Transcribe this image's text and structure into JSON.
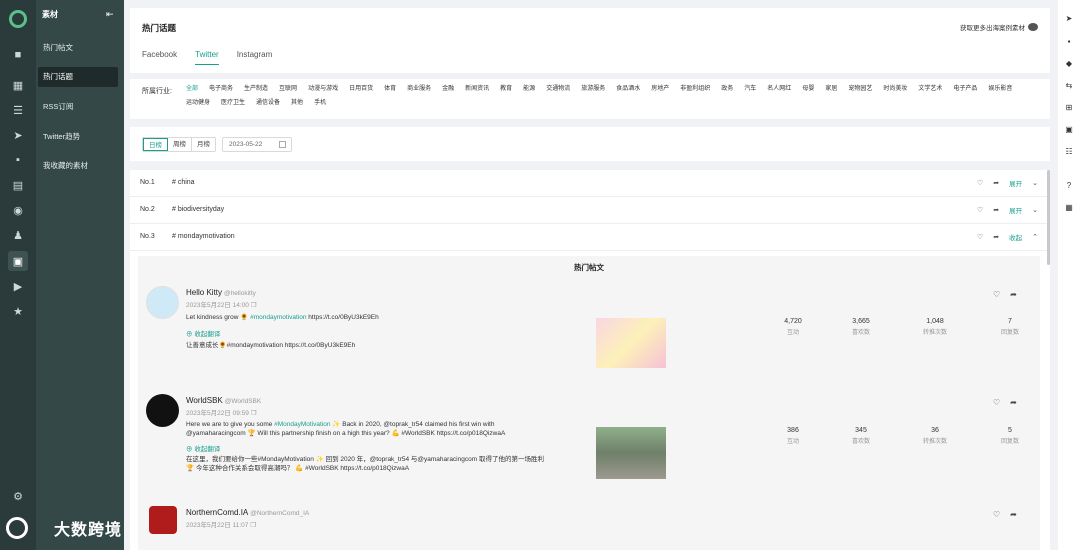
{
  "sidebar": {
    "title": "素材",
    "items": [
      {
        "label": "热门帖文",
        "active": false
      },
      {
        "label": "热门话题",
        "active": true
      },
      {
        "label": "RSS订阅",
        "active": false
      },
      {
        "label": "Twitter趋势",
        "active": false
      },
      {
        "label": "我收藏的素材",
        "active": false
      }
    ],
    "brand": "大数跨境"
  },
  "header": {
    "title": "热门话题",
    "more_link": "获取更多出海案例素材",
    "tabs": [
      "Facebook",
      "Twitter",
      "Instagram"
    ],
    "active_tab": "Twitter"
  },
  "industry": {
    "label": "所属行业:",
    "options": [
      "全部",
      "电子商务",
      "生产制造",
      "互联网",
      "动漫与游戏",
      "日用百货",
      "体育",
      "商业服务",
      "金融",
      "新闻资讯",
      "教育",
      "能源",
      "交通物流",
      "旅游服务",
      "食品酒水",
      "房地产",
      "非盈利组织",
      "政务",
      "汽车",
      "名人网红",
      "母婴",
      "家居",
      "宠物园艺",
      "时尚美妆",
      "文学艺术",
      "电子产品",
      "娱乐影音",
      "运动健身",
      "医疗卫生",
      "通信设备",
      "其他",
      "手机"
    ],
    "active": "全部"
  },
  "filter": {
    "periods": [
      "日榜",
      "周榜",
      "月榜"
    ],
    "active_period": "日榜",
    "date": "2023-05-22"
  },
  "topics": [
    {
      "rank": "No.1",
      "tag": "# china",
      "toggle": "展开"
    },
    {
      "rank": "No.2",
      "tag": "# biodiversityday",
      "toggle": "展开"
    },
    {
      "rank": "No.3",
      "tag": "# mondaymotivation",
      "toggle": "收起"
    }
  ],
  "panel": {
    "title": "热门帖文",
    "stat_labels": [
      "互动",
      "喜欢数",
      "转推次数",
      "回复数"
    ],
    "posts": [
      {
        "name": "Hello Kitty",
        "handle": "@hellokitty",
        "time": "2023年5月22日 14:00",
        "text_pre": "Let kindness grow 🌻 ",
        "text_hl": "#mondaymotivation",
        "text_post": " https://t.co/0ByU3kE9Eh",
        "translate": "收起翻译",
        "translation": "让善意成长🌻#mondaymotivation https://t.co/0ByU3kE9Eh",
        "stats": [
          "4,720",
          "3,665",
          "1,048",
          "7"
        ]
      },
      {
        "name": "WorldSBK",
        "handle": "@WorldSBK",
        "time": "2023年5月22日 09:59",
        "text_pre": "Here we are to give you some ",
        "text_hl": "#MondayMotivation",
        "text_post": " ✨ Back in 2020, @toprak_tr54 claimed his first win with @yamaharacingcom 🏆 Will this partnership finish on a high this year? 💪 #WorldSBK https://t.co/p018QizwaA",
        "translate": "收起翻译",
        "translation": "在这里，我们要给你一些#MondayMotivation ✨ 回到 2020 年，@toprak_tr54 与@yamaharacingcom 取得了他的第一场胜利🏆 今年这种合作关系会取得高潮吗？ 💪 #WorldSBK https://t.co/p018QizwaA",
        "stats": [
          "386",
          "345",
          "36",
          "5"
        ]
      },
      {
        "name": "NorthernComd.IA",
        "handle": "@NorthernComd_IA",
        "time": "2023年5月22日 11:07"
      }
    ]
  },
  "colors": {
    "accent": "#1a9e8c",
    "sidebar": "#344848",
    "iconbar": "#2b3a3a"
  }
}
